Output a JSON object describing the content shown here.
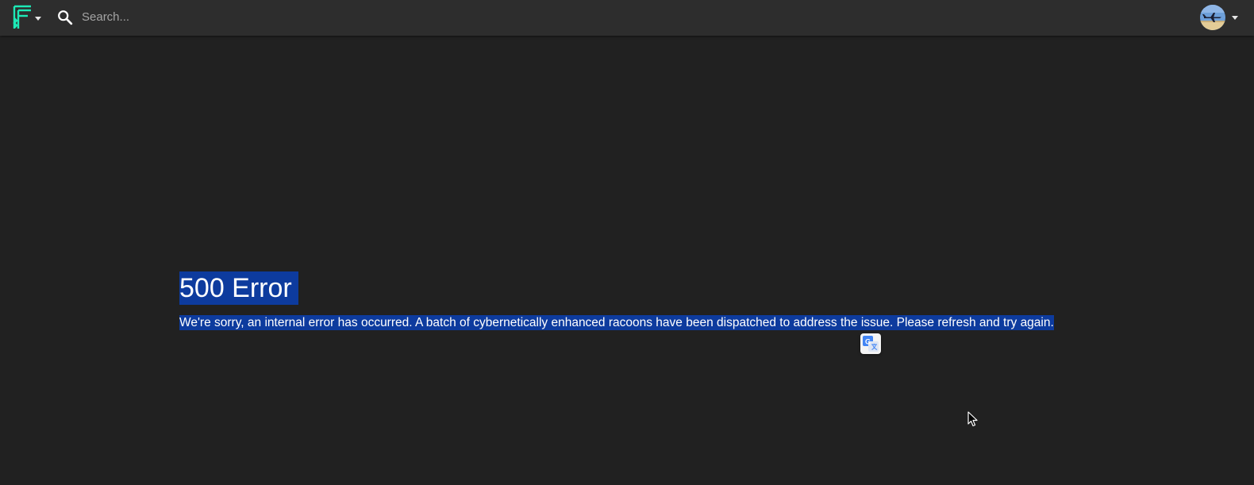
{
  "topbar": {
    "logo_icon": "flathub-logo-icon",
    "logo_color": "#1de9b6",
    "search": {
      "placeholder": "Search...",
      "value": "",
      "icon": "search-icon"
    },
    "user_menu": {
      "avatar": "airplane-avatar",
      "caret_icon": "caret-down-icon"
    }
  },
  "error": {
    "title": "500 Error",
    "message": "We're sorry, an internal error has occurred. A batch of cybernetically enhanced racoons have been dispatched to address the issue. Please refresh and try again."
  },
  "overlay": {
    "translate_icon": "google-translate-icon",
    "selection_color": "#0d3b9e"
  }
}
